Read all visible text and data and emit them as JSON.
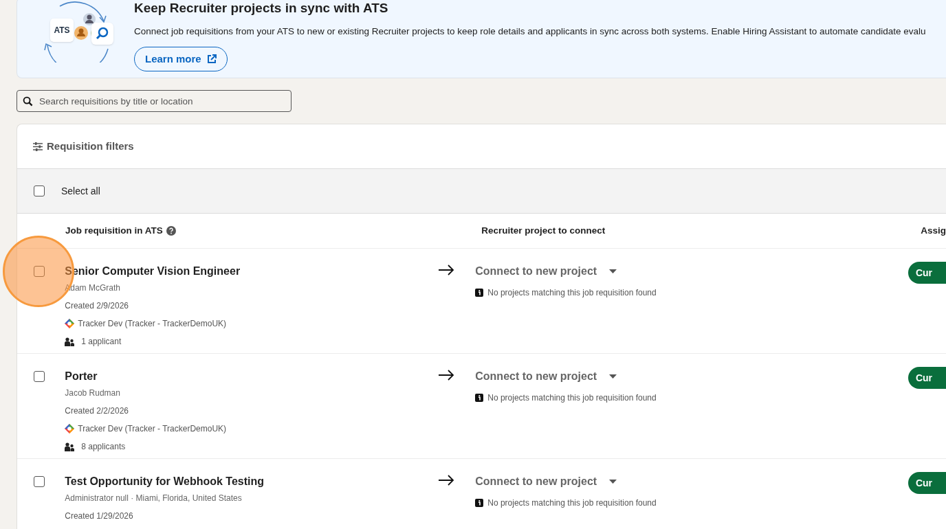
{
  "banner": {
    "title": "Keep Recruiter projects in sync with ATS",
    "illustration_label": "ATS",
    "description": "Connect job requisitions from your ATS to new or existing Recruiter projects to keep role details and applicants in sync across both systems. Enable Hiring Assistant to automate candidate evalu",
    "button": "Learn more"
  },
  "search": {
    "placeholder": "Search requisitions by title or location"
  },
  "filters": {
    "label": "Requisition filters"
  },
  "select_all": {
    "label": "Select all",
    "checked": false
  },
  "columns": [
    "Job requisition in ATS",
    "Recruiter project to connect",
    "Assig"
  ],
  "rows": [
    {
      "title": "Senior Computer Vision Engineer",
      "owner": "Adam McGrath",
      "created": "Created 2/9/2026",
      "source": "Tracker Dev (Tracker - TrackerDemoUK)",
      "applicants": "1 applicant",
      "checked": false,
      "project": "Connect to new project",
      "note": "No projects matching this job requisition found",
      "badge": "Cur"
    },
    {
      "title": "Porter",
      "owner": "Jacob Rudman",
      "created": "Created 2/2/2026",
      "source": "Tracker Dev (Tracker - TrackerDemoUK)",
      "applicants": "8 applicants",
      "checked": false,
      "project": "Connect to new project",
      "note": "No projects matching this job requisition found",
      "badge": "Cur"
    },
    {
      "title": "Test Opportunity for Webhook Testing",
      "owner": "Administrator null · Miami, Florida, United States",
      "created": "Created 1/29/2026",
      "checked": false,
      "project": "Connect to new project",
      "note": "No projects matching this job requisition found",
      "badge": "Cur"
    }
  ]
}
